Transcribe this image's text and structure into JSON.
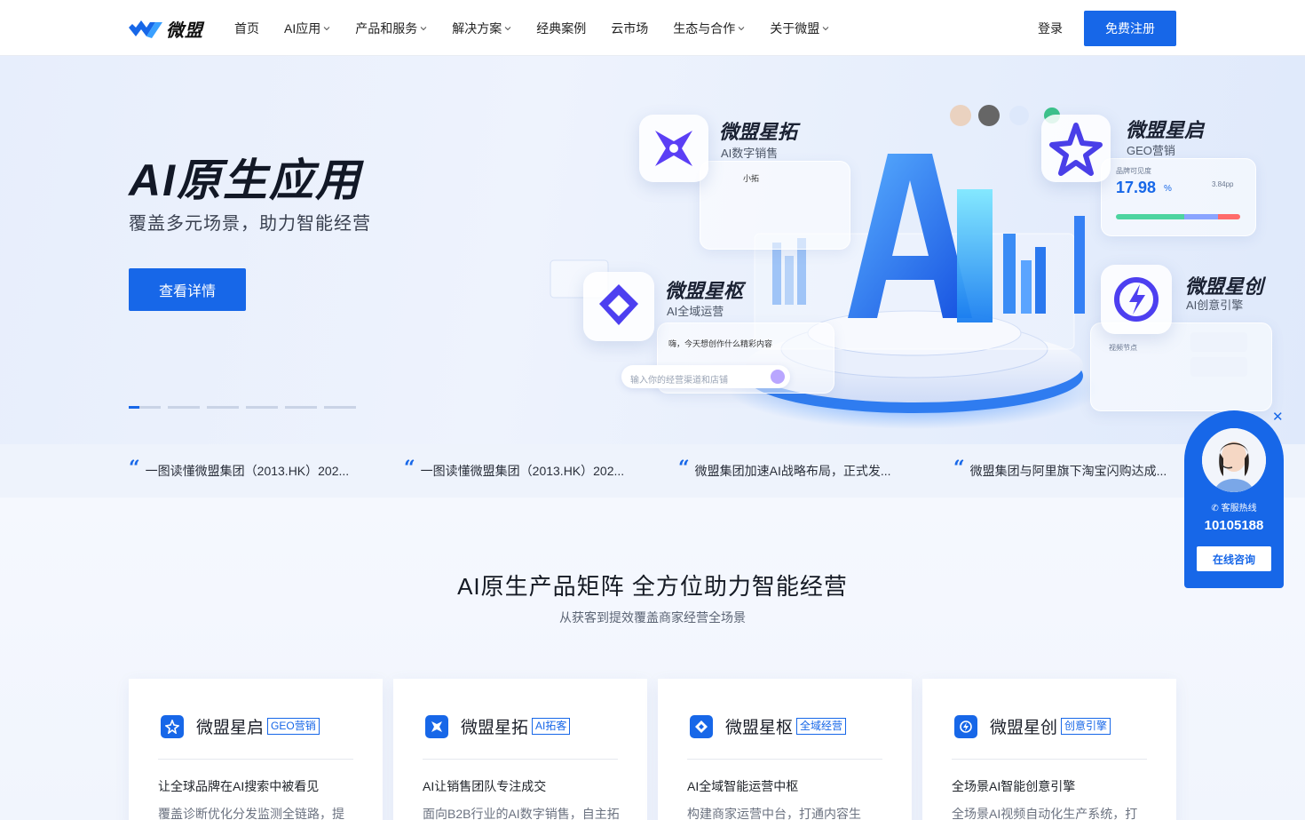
{
  "header": {
    "logo_text": "微盟",
    "nav": [
      {
        "label": "首页",
        "has_dropdown": false
      },
      {
        "label": "AI应用",
        "has_dropdown": true
      },
      {
        "label": "产品和服务",
        "has_dropdown": true
      },
      {
        "label": "解决方案",
        "has_dropdown": true
      },
      {
        "label": "经典案例",
        "has_dropdown": false
      },
      {
        "label": "云市场",
        "has_dropdown": false
      },
      {
        "label": "生态与合作",
        "has_dropdown": true
      },
      {
        "label": "关于微盟",
        "has_dropdown": true
      }
    ],
    "login_label": "登录",
    "register_label": "免费注册"
  },
  "hero": {
    "title": "AI原生应用",
    "subtitle": "覆盖多元场景，助力智能经营",
    "button_label": "查看详情",
    "slide_count": 6,
    "active_slide": 1,
    "art": {
      "center_letter": "AI",
      "products": [
        {
          "name": "微盟星拓",
          "desc": "AI数字销售"
        },
        {
          "name": "微盟星启",
          "desc": "GEO营销"
        },
        {
          "name": "微盟星枢",
          "desc": "AI全域运营"
        },
        {
          "name": "微盟星创",
          "desc": "AI创意引擎"
        }
      ],
      "chat_name": "小拓",
      "metric_label": "品牌可见度",
      "metric_value": "17.98",
      "metric_unit": "%",
      "metric_side": "3.84pp",
      "prompt_text": "嗨，今天想创作什么精彩内容",
      "input_placeholder": "输入你的经营渠道和店铺",
      "node_label": "视频节点"
    }
  },
  "news": [
    "一图读懂微盟集团（2013.HK）202...",
    "一图读懂微盟集团（2013.HK）202...",
    "微盟集团加速AI战略布局，正式发...",
    "微盟集团与阿里旗下淘宝闪购达成..."
  ],
  "section": {
    "title": "AI原生产品矩阵 全方位助力智能经营",
    "subtitle": "从获客到提效覆盖商家经营全场景",
    "cards": [
      {
        "name": "微盟星启",
        "tag": "GEO营销",
        "title": "让全球品牌在AI搜索中被看见",
        "desc": "覆盖诊断优化分发监测全链路，提",
        "icon": "star-compass-icon"
      },
      {
        "name": "微盟星拓",
        "tag": "AI拓客",
        "title": "AI让销售团队专注成交",
        "desc": "面向B2B行业的AI数字销售，自主拓",
        "icon": "cross-star-icon"
      },
      {
        "name": "微盟星枢",
        "tag": "全域经营",
        "title": "AI全域智能运营中枢",
        "desc": "构建商家运营中台，打通内容生",
        "icon": "hub-icon"
      },
      {
        "name": "微盟星创",
        "tag": "创意引擎",
        "title": "全场景AI智能创意引擎",
        "desc": "全场景AI视频自动化生产系统，打",
        "icon": "spark-icon"
      }
    ]
  },
  "service": {
    "hotline_label": "客服热线",
    "phone": "10105188",
    "button_label": "在线咨询",
    "close_symbol": "✕"
  },
  "colors": {
    "brand": "#1767e8",
    "text": "#1f2329",
    "hero_bg": "#e7eefc"
  }
}
